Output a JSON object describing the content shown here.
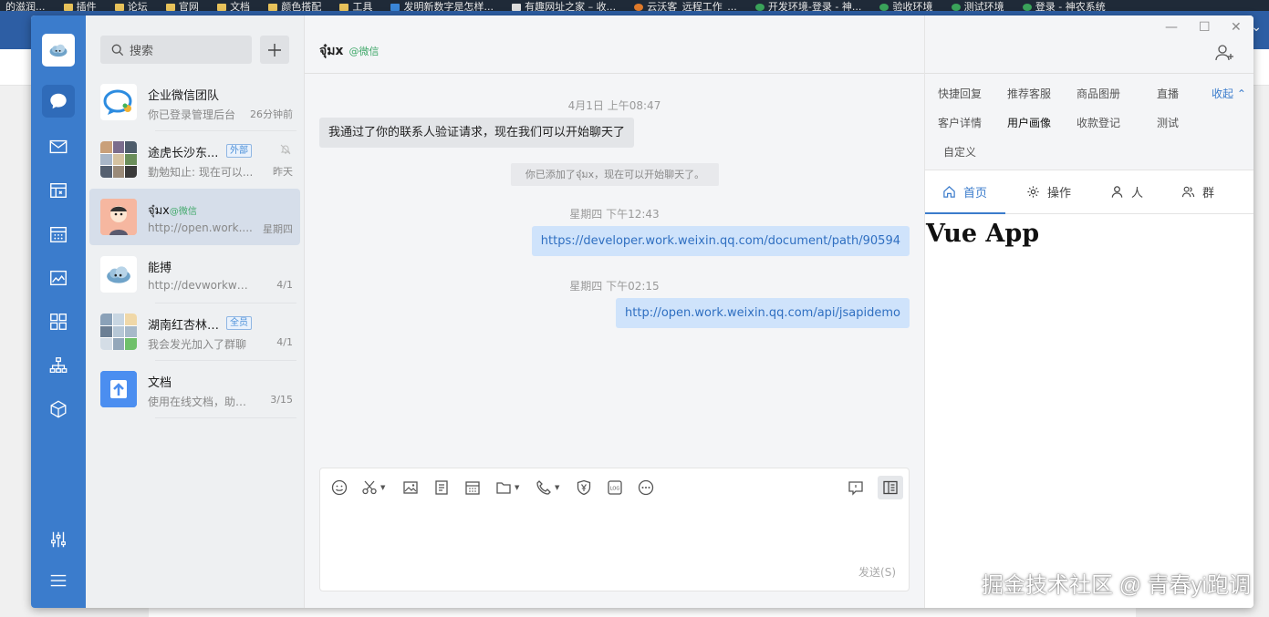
{
  "browser": {
    "bookmarks": [
      {
        "label": "的滋润...",
        "icon": "none"
      },
      {
        "label": "插件",
        "icon": "folder-icon"
      },
      {
        "label": "论坛",
        "icon": "folder-icon"
      },
      {
        "label": "官网",
        "icon": "folder-icon"
      },
      {
        "label": "文档",
        "icon": "folder-icon"
      },
      {
        "label": "颜色搭配",
        "icon": "folder-icon"
      },
      {
        "label": "工具",
        "icon": "folder-icon"
      },
      {
        "label": "发明新数字是怎样...",
        "icon": "site-icon"
      },
      {
        "label": "有趣网址之家 – 收...",
        "icon": "site-icon"
      },
      {
        "label": "云沃客_远程工作_...",
        "icon": "site-icon"
      },
      {
        "label": "开发环境-登录 - 神...",
        "icon": "leaf-icon"
      },
      {
        "label": "验收环境",
        "icon": "leaf-icon"
      },
      {
        "label": "测试环境",
        "icon": "leaf-icon"
      },
      {
        "label": "登录 - 神农系统",
        "icon": "leaf-icon"
      }
    ]
  },
  "colors": {
    "nav_bg": "#3b7ccc",
    "accent": "#3b7ccc",
    "wechat_green": "#40a86a"
  },
  "nav": {
    "items": [
      "chat-icon",
      "mail-icon",
      "workbench-icon",
      "calendar-icon",
      "report-icon",
      "apps-icon",
      "contacts-icon",
      "cube-icon"
    ],
    "bottom": [
      "settings-sliders-icon",
      "menu-icon"
    ]
  },
  "conversation_list": {
    "search_placeholder": "搜索",
    "items": [
      {
        "name": "企业微信团队",
        "preview": "你已登录管理后台",
        "time": "26分钟前",
        "badge": "",
        "sub": ""
      },
      {
        "name": "途虎长沙东...",
        "preview": "勤勉知止: 现在可以...",
        "time": "昨天",
        "badge": "外部",
        "sub": ""
      },
      {
        "name": "จุ๋มx",
        "preview": "http://open.work....",
        "time": "星期四",
        "badge": "",
        "sub": "@微信"
      },
      {
        "name": "能搏",
        "preview": "http://devworkweixi ...",
        "time": "4/1",
        "badge": "",
        "sub": ""
      },
      {
        "name": "湖南红杏林科...",
        "preview": "我会发光加入了群聊",
        "time": "4/1",
        "badge": "全员",
        "sub": ""
      },
      {
        "name": "文档",
        "preview": "使用在线文档，助力...",
        "time": "3/15",
        "badge": "",
        "sub": ""
      }
    ]
  },
  "chat": {
    "title": "จุ๋มx",
    "via": "@微信",
    "messages": [
      {
        "kind": "time",
        "text": "4月1日 上午08:47"
      },
      {
        "kind": "in",
        "text": "我通过了你的联系人验证请求，现在我们可以开始聊天了"
      },
      {
        "kind": "system",
        "text": "你已添加了จุ๋มx，现在可以开始聊天了。"
      },
      {
        "kind": "time",
        "text": "星期四 下午12:43"
      },
      {
        "kind": "out",
        "text": "https://developer.work.weixin.qq.com/document/path/90594"
      },
      {
        "kind": "time",
        "text": "星期四 下午02:15"
      },
      {
        "kind": "out",
        "text": "http://open.work.weixin.qq.com/api/jsapidemo"
      }
    ],
    "send_label": "发送(S)"
  },
  "side_panel": {
    "menu_rows": [
      [
        "快捷回复",
        "推荐客服",
        "商品图册",
        "直播"
      ],
      [
        "客户详情",
        "用户画像",
        "收款登记",
        "测试"
      ],
      [
        "自定义"
      ]
    ],
    "collapse_label": "收起",
    "tabs": [
      "首页",
      "操作",
      "人",
      "群"
    ],
    "active_tab": "首页",
    "content_heading": "Vue App"
  },
  "watermark": "掘金技术社区 @ 青春yi跑调"
}
